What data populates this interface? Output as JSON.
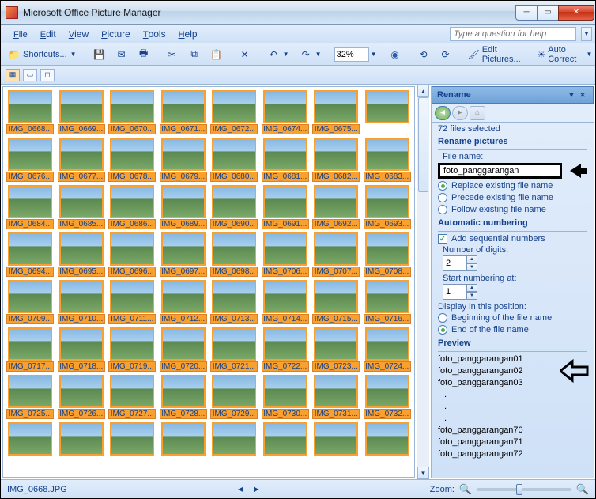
{
  "title": "Microsoft Office Picture Manager",
  "menu": {
    "file": "File",
    "edit": "Edit",
    "view": "View",
    "picture": "Picture",
    "tools": "Tools",
    "help": "Help"
  },
  "helpbox_placeholder": "Type a question for help",
  "toolbar": {
    "shortcuts": "Shortcuts...",
    "zoom_value": "32%",
    "edit_pictures": "Edit Pictures...",
    "auto_correct": "Auto Correct"
  },
  "thumbnails": [
    "IMG_0668...",
    "IMG_0669...",
    "IMG_0670...",
    "IMG_0671...",
    "IMG_0672...",
    "IMG_0674...",
    "IMG_0675...",
    "",
    "IMG_0676...",
    "IMG_0677...",
    "IMG_0678...",
    "IMG_0679...",
    "IMG_0680...",
    "IMG_0681...",
    "IMG_0682...",
    "IMG_0683...",
    "IMG_0684...",
    "IMG_0685...",
    "IMG_0686...",
    "IMG_0689...",
    "IMG_0690...",
    "IMG_0691...",
    "IMG_0692...",
    "IMG_0693...",
    "IMG_0694...",
    "IMG_0695...",
    "IMG_0696...",
    "IMG_0697...",
    "IMG_0698...",
    "IMG_0706...",
    "IMG_0707...",
    "IMG_0708...",
    "IMG_0709...",
    "IMG_0710...",
    "IMG_0711...",
    "IMG_0712...",
    "IMG_0713...",
    "IMG_0714...",
    "IMG_0715...",
    "IMG_0716...",
    "IMG_0717...",
    "IMG_0718...",
    "IMG_0719...",
    "IMG_0720...",
    "IMG_0721...",
    "IMG_0722...",
    "IMG_0723...",
    "IMG_0724...",
    "IMG_0725...",
    "IMG_0726...",
    "IMG_0727...",
    "IMG_0728...",
    "IMG_0729...",
    "IMG_0730...",
    "IMG_0731...",
    "IMG_0732...",
    "",
    "",
    "",
    "",
    "",
    "",
    "",
    ""
  ],
  "pane": {
    "title": "Rename",
    "selected_count": "72 files selected",
    "section_rename": "Rename pictures",
    "filename_label": "File name:",
    "filename_value": "foto_panggarangan",
    "opt_replace": "Replace existing file name",
    "opt_precede": "Precede existing file name",
    "opt_follow": "Follow existing file name",
    "section_auto": "Automatic numbering",
    "chk_addseq": "Add sequential numbers",
    "digits_label": "Number of digits:",
    "digits_value": "2",
    "start_label": "Start numbering at:",
    "start_value": "1",
    "display_label": "Display in this position:",
    "opt_begin": "Beginning of the file name",
    "opt_end": "End of the file name",
    "section_preview": "Preview",
    "previews_top": [
      "foto_panggarangan01",
      "foto_panggarangan02",
      "foto_panggarangan03"
    ],
    "previews_bot": [
      "foto_panggarangan70",
      "foto_panggarangan71",
      "foto_panggarangan72"
    ]
  },
  "status": {
    "filename": "IMG_0668.JPG",
    "zoom_label": "Zoom:"
  }
}
